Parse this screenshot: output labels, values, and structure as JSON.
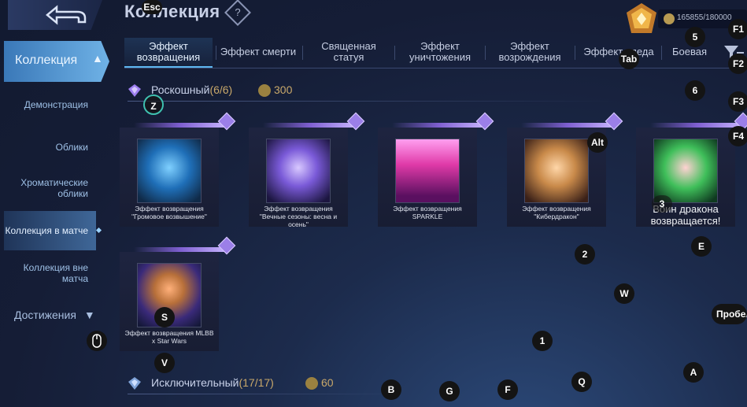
{
  "header": {
    "title": "Коллекция",
    "help_icon": "?",
    "points": "165855/180000"
  },
  "sidebar": {
    "main": "Коллекция",
    "items": [
      {
        "label": "Демонстрация"
      },
      {
        "label": "Облики"
      },
      {
        "label": "Хроматические облики"
      },
      {
        "label": "Коллекция в матче"
      },
      {
        "label": "Коллекция вне матча"
      }
    ],
    "achievements": "Достижения"
  },
  "tabs": [
    {
      "label": "Эффект возвращения"
    },
    {
      "label": "Эффект смерти"
    },
    {
      "label": "Священная статуя"
    },
    {
      "label": "Эффект уничтожения"
    },
    {
      "label": "Эффект возрождения"
    },
    {
      "label": "Эффект следа"
    },
    {
      "label": "Боевая"
    }
  ],
  "sections": {
    "luxury": {
      "name": "Роскошный",
      "count": "(6/6)",
      "cost": "300"
    },
    "exclusive": {
      "name": "Исключительный",
      "count": "(17/17)",
      "cost": "60"
    }
  },
  "cards": [
    {
      "label": "Эффект возвращения \"Громовое возвышение\"",
      "color": "#2a7fd0"
    },
    {
      "label": "Эффект возвращения \"Вечные сезоны: весна и осень\"",
      "color": "#8a6fe0"
    },
    {
      "label": "Эффект возвращения SPARKLE",
      "color": "#e03aa8"
    },
    {
      "label": "Эффект возвращения \"Кибердракон\"",
      "color": "#c98a4a"
    },
    {
      "label": "Воин дракона возвращается!",
      "color": "#3fbf5a"
    },
    {
      "label": "Эффект возвращения MLBB x Star Wars",
      "color": "#b8703a"
    }
  ],
  "keys": {
    "esc": "Esc",
    "f1": "F1",
    "f2": "F2",
    "f3": "F3",
    "f4": "F4",
    "tab": "Tab",
    "alt": "Alt",
    "z": "Z",
    "s": "S",
    "v": "V",
    "b": "B",
    "g": "G",
    "f": "F",
    "q": "Q",
    "a": "A",
    "e": "E",
    "w": "W",
    "n1": "1",
    "n2": "2",
    "n3": "3",
    "n5": "5",
    "n6": "6",
    "space": "Пробел"
  }
}
